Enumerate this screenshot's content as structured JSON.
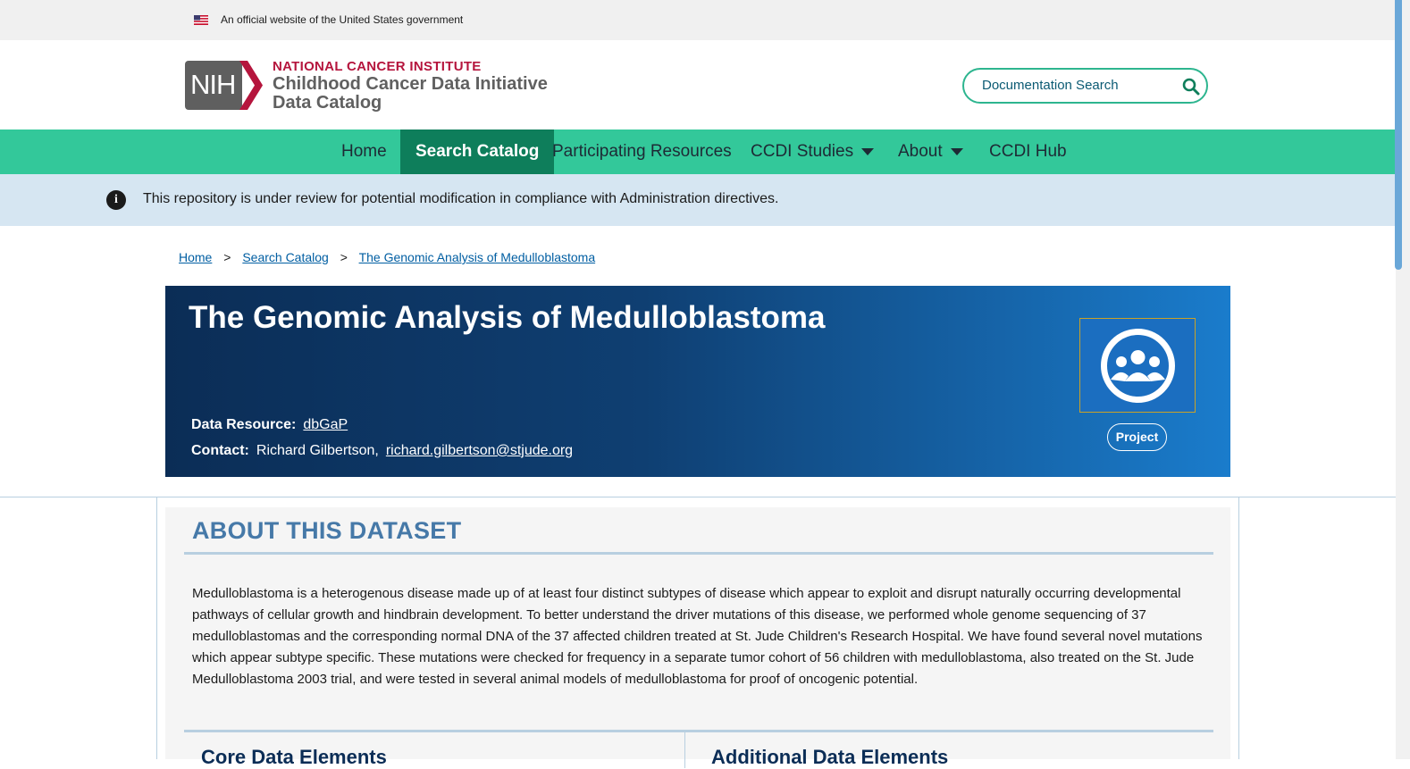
{
  "gov_banner": {
    "text": "An official website of the United States government"
  },
  "header": {
    "logo_text": "NIH",
    "institute": "NATIONAL CANCER INSTITUTE",
    "site_line1": "Childhood Cancer Data Initiative",
    "site_line2": "Data Catalog",
    "search_placeholder": "Documentation Search"
  },
  "nav": {
    "items": [
      {
        "label": "Home"
      },
      {
        "label": "Search Catalog",
        "active": true
      },
      {
        "label": "Participating Resources"
      },
      {
        "label": "CCDI Studies",
        "dropdown": true
      },
      {
        "label": "About",
        "dropdown": true
      },
      {
        "label": "CCDI Hub"
      }
    ]
  },
  "alert": {
    "text": "This repository is under review for potential modification in compliance with Administration directives."
  },
  "breadcrumb": {
    "items": [
      "Home",
      "Search Catalog",
      "The Genomic Analysis of Medulloblastoma"
    ],
    "separator": ">"
  },
  "hero": {
    "title": "The Genomic Analysis of Medulloblastoma",
    "data_resource_label": "Data Resource:",
    "data_resource_value": "dbGaP",
    "contact_label": "Contact:",
    "contact_name": "Richard Gilbertson,",
    "contact_email": "richard.gilbertson@stjude.org",
    "badge": "Project"
  },
  "about": {
    "heading": "ABOUT THIS DATASET",
    "description": "Medulloblastoma is a heterogenous disease made up of at least four distinct subtypes of disease which appear to exploit and disrupt naturally occurring developmental pathways of cellular growth and hindbrain development. To better understand the driver mutations of this disease, we performed whole genome sequencing of 37 medulloblastomas and the corresponding normal DNA of the 37 affected children treated at St. Jude Children's Research Hospital. We have found several novel mutations which appear subtype specific. These mutations were checked for frequency in a separate tumor cohort of 56 children with medulloblastoma, also treated on the St. Jude Medulloblastoma 2003 trial, and were tested in several animal models of medulloblastoma for proof of oncogenic potential.",
    "left_subheading": "Core Data Elements",
    "right_subheading": "Additional Data Elements"
  },
  "colors": {
    "nav_bg": "#33c89a",
    "nav_active": "#0e7e5b",
    "alert_bg": "#d6e6f2",
    "hero_start": "#0b2d56",
    "hero_end": "#1a7ccc",
    "heading_blue": "#4679a8",
    "nci_red": "#b5153d"
  },
  "icons": {
    "search": "search-icon",
    "info": "info-icon",
    "project": "people-group-icon",
    "flag": "us-flag-icon"
  }
}
